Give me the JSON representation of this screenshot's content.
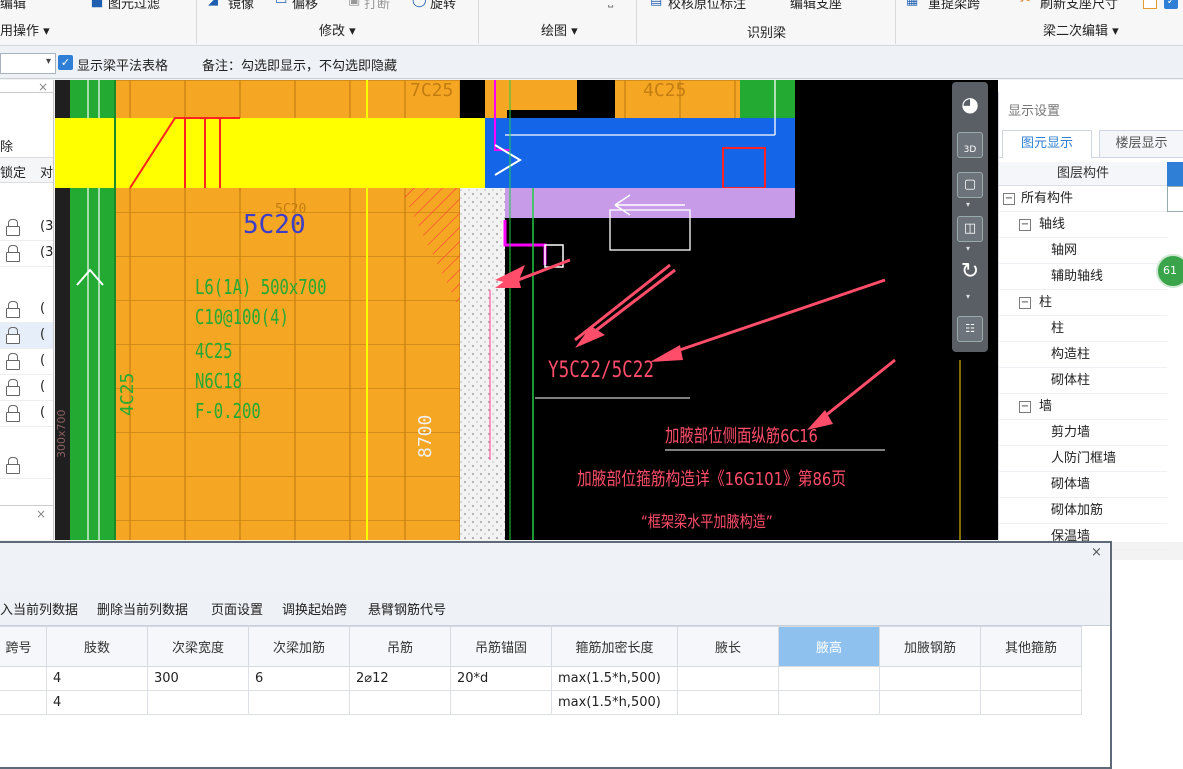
{
  "ribbon": {
    "top_items": [
      "编辑",
      "图元过滤",
      "镜像",
      "偏移",
      "打断",
      "旋转",
      "校核原位标注",
      "编辑支座",
      "重提梁跨",
      "刷新支座尺寸"
    ],
    "groups": {
      "general": "用操作",
      "modify": "修改",
      "draw": "绘图",
      "recognize": "识别梁",
      "secondary_edit": "梁二次编辑"
    }
  },
  "toolbar2": {
    "checkbox_label": "显示梁平法表格",
    "checkbox_checked": true,
    "note": "备注：勾选即显示，不勾选即隐藏"
  },
  "left_panel": {
    "delete_label": "除",
    "col_lock": "锁定",
    "col_other": "对",
    "row_marks": [
      "(3",
      "(3",
      "(",
      "(",
      "(",
      "(",
      "(",
      "",
      ""
    ],
    "side_text": "300x700"
  },
  "canvas": {
    "beam_label_big": "5C20",
    "beam_spec": [
      "L6(1A) 500x700",
      "C10@100(4)",
      "4C25",
      "N6C18",
      "F-0.200"
    ],
    "top_labels": [
      "7C25",
      "4C25"
    ],
    "left_vertical": "4C25",
    "col_label": "8700",
    "small_label": "5C20",
    "rebar_text": "Y5C22/5C22",
    "red_note1": "加腋部位侧面纵筋6C16",
    "red_note2": "加腋部位箍筋构造详《16G101》第86页",
    "red_note3": "“框架梁水平加腋构造”"
  },
  "view_toolbar": {
    "buttons": [
      "orbit",
      "3D",
      "front",
      "cube",
      "rotate",
      "menu"
    ],
    "btn_3d_label": "3D"
  },
  "right_panel": {
    "title": "显示设置",
    "tabs": [
      "图元显示",
      "楼层显示"
    ],
    "active_tab": 0,
    "column_header": "图层构件",
    "tree": [
      {
        "label": "所有构件",
        "level": 0,
        "expand": "−"
      },
      {
        "label": "轴线",
        "level": 1,
        "expand": "−"
      },
      {
        "label": "轴网",
        "level": 2
      },
      {
        "label": "辅助轴线",
        "level": 2
      },
      {
        "label": "柱",
        "level": 1,
        "expand": "−"
      },
      {
        "label": "柱",
        "level": 2
      },
      {
        "label": "构造柱",
        "level": 2
      },
      {
        "label": "砌体柱",
        "level": 2
      },
      {
        "label": "墙",
        "level": 1,
        "expand": "−"
      },
      {
        "label": "剪力墙",
        "level": 2
      },
      {
        "label": "人防门框墙",
        "level": 2
      },
      {
        "label": "砌体墙",
        "level": 2
      },
      {
        "label": "砌体加筋",
        "level": 2
      },
      {
        "label": "保温墙",
        "level": 2
      }
    ],
    "badge": "61"
  },
  "dialog": {
    "close": "×",
    "actions": [
      "入当前列数据",
      "删除当前列数据",
      "页面设置",
      "调换起始跨",
      "悬臂钢筋代号"
    ],
    "columns": [
      "跨号",
      "肢数",
      "次梁宽度",
      "次梁加筋",
      "吊筋",
      "吊筋锚固",
      "箍筋加密长度",
      "腋长",
      "腋高",
      "加腋钢筋",
      "其他箍筋"
    ],
    "selected_column": 8,
    "rows": [
      [
        "",
        "4",
        "300",
        "6",
        "2⌀12",
        "20*d",
        "max(1.5*h,500)",
        "",
        "",
        "",
        ""
      ],
      [
        "",
        "4",
        "",
        "",
        "",
        "",
        "max(1.5*h,500)",
        "",
        "",
        "",
        ""
      ]
    ]
  },
  "colors": {
    "canvas_bg": "#000000",
    "orange_beam": "#f5a623",
    "yellow_beam": "#ffff00",
    "blue_beam": "#1565e8",
    "red_annotation": "#ff4d6a",
    "accent": "#2f7fd6"
  }
}
